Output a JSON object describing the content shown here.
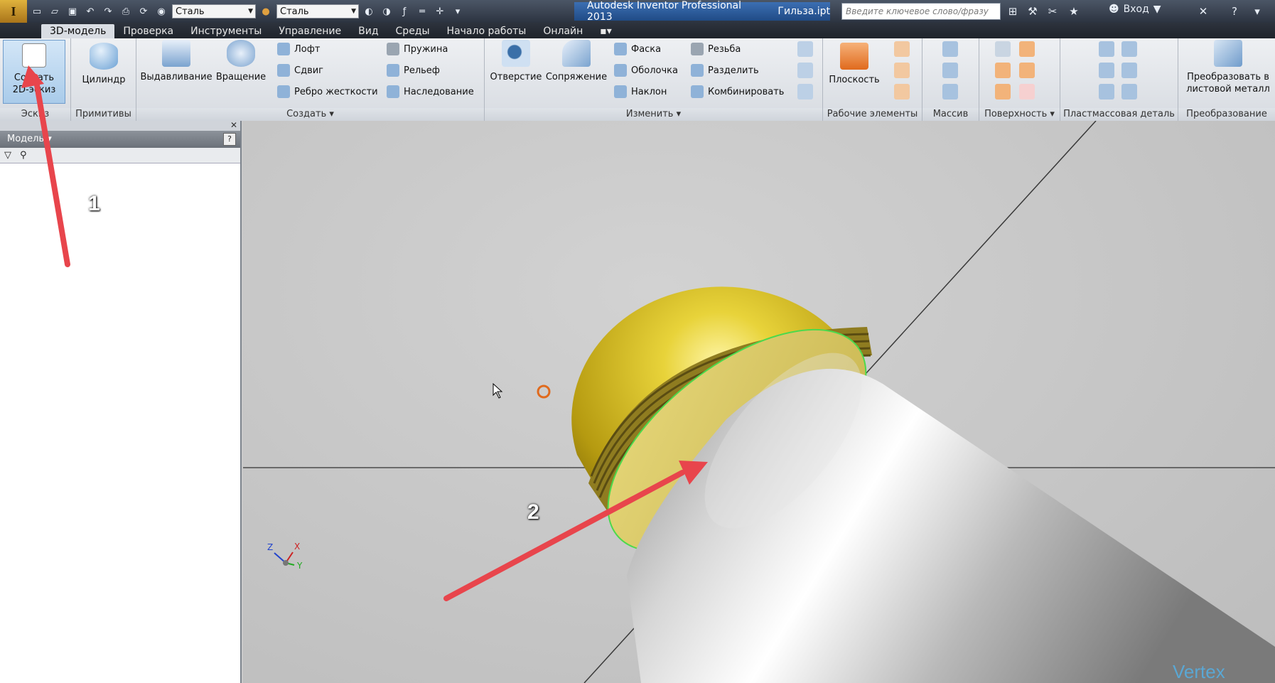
{
  "titlebar": {
    "logo_label": "I",
    "material_combo": "Сталь",
    "appearance_combo": "Сталь",
    "app_title": "Autodesk Inventor Professional 2013",
    "file_name": "Гильза.ipt",
    "search_placeholder": "Введите ключевое слово/фразу",
    "signin_label": "Вход"
  },
  "tabs": [
    "3D-модель",
    "Проверка",
    "Инструменты",
    "Управление",
    "Вид",
    "Среды",
    "Начало работы",
    "Онлайн"
  ],
  "ribbon": {
    "sketch": {
      "button": "Создать 2D-эскиз",
      "label": "Эскиз"
    },
    "primitives": {
      "button": "Цилиндр",
      "label": "Примитивы"
    },
    "create": {
      "label": "Создать",
      "big": [
        "Выдавливание",
        "Вращение"
      ],
      "small": [
        "Лофт",
        "Сдвиг",
        "Ребро жесткости",
        "Пружина",
        "Рельеф",
        "Наследование"
      ]
    },
    "modify": {
      "label": "Изменить",
      "big": [
        "Отверстие",
        "Сопряжение"
      ],
      "small": [
        "Фаска",
        "Оболочка",
        "Наклон",
        "Резьба",
        "Разделить",
        "Комбинировать"
      ]
    },
    "work_features": {
      "button": "Плоскость",
      "label": "Рабочие элементы"
    },
    "pattern": {
      "label": "Массив"
    },
    "surface": {
      "label": "Поверхность"
    },
    "plastic": {
      "label": "Пластмассовая деталь"
    },
    "convert": {
      "button": "Преобразовать в листовой металл",
      "label": "Преобразование"
    }
  },
  "browser": {
    "header": "Модель",
    "help": "?"
  },
  "callouts": {
    "one": "1",
    "two": "2"
  },
  "triad": {
    "z": "Z",
    "x": "X",
    "y": "Y"
  },
  "watermark": "Vertex",
  "colors": {
    "sphere": "#d8c12a",
    "cylinder": "#d6d6d6",
    "arrow": "#e8454c",
    "edge_highlight": "#4cd94c"
  }
}
